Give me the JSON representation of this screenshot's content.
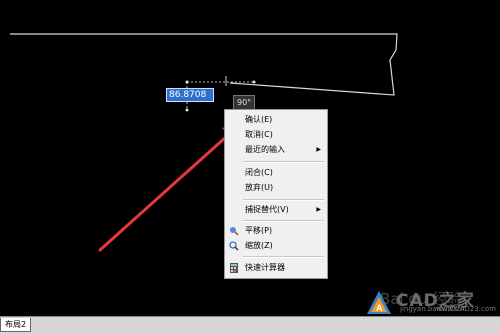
{
  "dynamic_input": {
    "value": "86.8708"
  },
  "angle_tooltip": {
    "text": "90°"
  },
  "context_menu": {
    "items": [
      {
        "label": "确认(E)"
      },
      {
        "label": "取消(C)"
      },
      {
        "label": "最近的输入",
        "submenu": true
      },
      {
        "label": "闭合(C)"
      },
      {
        "label": "放弃(U)"
      },
      {
        "label": "捕捉替代(V)",
        "submenu": true
      },
      {
        "label": "平移(P)",
        "icon": "pan-icon"
      },
      {
        "label": "缩放(Z)",
        "icon": "zoom-icon"
      },
      {
        "label": "快速计算器",
        "icon": "calculator-icon"
      }
    ]
  },
  "layout_tab": {
    "label": "布局2"
  },
  "watermark": {
    "brand": "CAD之家",
    "url": "www.CAD23.com",
    "faint_url": "jingyan.baidu.com",
    "faint_text": "Bai du 经验"
  },
  "colors": {
    "background": "#000000",
    "arrow": "#e8373a",
    "input_highlight": "#2f6fce"
  }
}
